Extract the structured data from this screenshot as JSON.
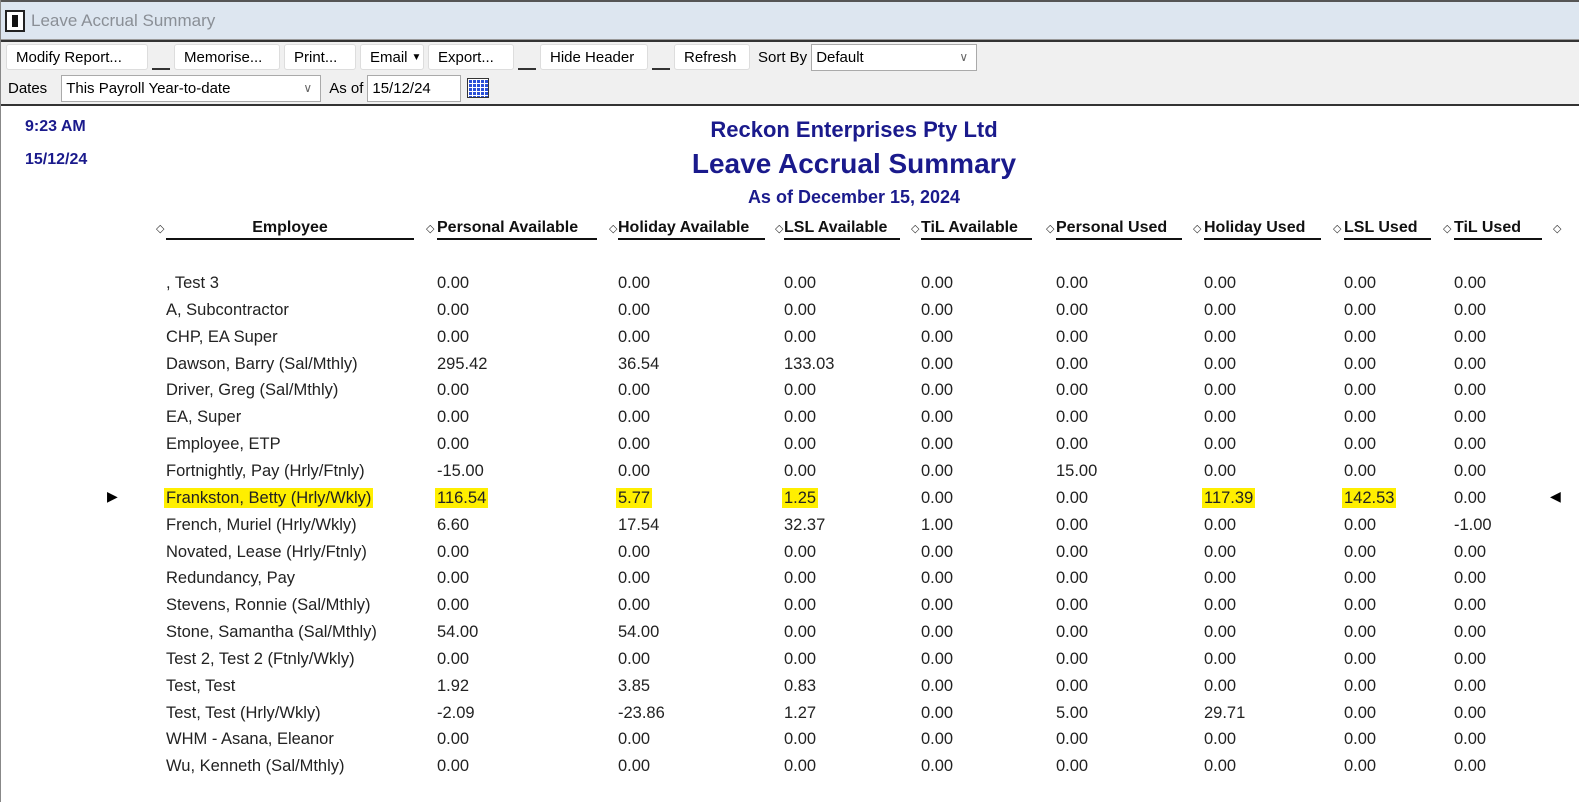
{
  "window": {
    "title": "Leave Accrual Summary"
  },
  "toolbar": {
    "modify": "Modify Report...",
    "memorise": "Memorise...",
    "print": "Print...",
    "email": "Email",
    "export": "Export...",
    "hide_header": "Hide Header",
    "refresh": "Refresh",
    "sort_by_label": "Sort By",
    "sort_by_value": "Default"
  },
  "datesbar": {
    "dates_label": "Dates",
    "dates_value": "This Payroll Year-to-date",
    "as_of_label": "As of",
    "as_of_value": "15/12/24"
  },
  "report": {
    "time": "9:23 AM",
    "date": "15/12/24",
    "company": "Reckon Enterprises Pty Ltd",
    "title": "Leave Accrual Summary",
    "subtitle": "As of December 15, 2024",
    "highlight_color": "#ffef00",
    "columns": [
      "Employee",
      "Personal Available",
      "Holiday Available",
      "LSL Available",
      "TiL Available",
      "Personal Used",
      "Holiday Used",
      "LSL Used",
      "TiL Used"
    ],
    "rows": [
      {
        "cells": [
          ", Test 3",
          "0.00",
          "0.00",
          "0.00",
          "0.00",
          "0.00",
          "0.00",
          "0.00",
          "0.00"
        ]
      },
      {
        "cells": [
          "A, Subcontractor",
          "0.00",
          "0.00",
          "0.00",
          "0.00",
          "0.00",
          "0.00",
          "0.00",
          "0.00"
        ]
      },
      {
        "cells": [
          "CHP, EA Super",
          "0.00",
          "0.00",
          "0.00",
          "0.00",
          "0.00",
          "0.00",
          "0.00",
          "0.00"
        ]
      },
      {
        "cells": [
          "Dawson, Barry (Sal/Mthly)",
          "295.42",
          "36.54",
          "133.03",
          "0.00",
          "0.00",
          "0.00",
          "0.00",
          "0.00"
        ]
      },
      {
        "cells": [
          "Driver, Greg (Sal/Mthly)",
          "0.00",
          "0.00",
          "0.00",
          "0.00",
          "0.00",
          "0.00",
          "0.00",
          "0.00"
        ]
      },
      {
        "cells": [
          "EA, Super",
          "0.00",
          "0.00",
          "0.00",
          "0.00",
          "0.00",
          "0.00",
          "0.00",
          "0.00"
        ]
      },
      {
        "cells": [
          "Employee, ETP",
          "0.00",
          "0.00",
          "0.00",
          "0.00",
          "0.00",
          "0.00",
          "0.00",
          "0.00"
        ]
      },
      {
        "cells": [
          "Fortnightly, Pay (Hrly/Ftnly)",
          "-15.00",
          "0.00",
          "0.00",
          "0.00",
          "15.00",
          "0.00",
          "0.00",
          "0.00"
        ]
      },
      {
        "cells": [
          "Frankston, Betty (Hrly/Wkly)",
          "116.54",
          "5.77",
          "1.25",
          "0.00",
          "0.00",
          "117.39",
          "142.53",
          "0.00"
        ],
        "selected": true,
        "highlighted": [
          0,
          1,
          2,
          3,
          6,
          7
        ]
      },
      {
        "cells": [
          "French, Muriel (Hrly/Wkly)",
          "6.60",
          "17.54",
          "32.37",
          "1.00",
          "0.00",
          "0.00",
          "0.00",
          "-1.00"
        ]
      },
      {
        "cells": [
          "Novated, Lease  (Hrly/Ftnly)",
          "0.00",
          "0.00",
          "0.00",
          "0.00",
          "0.00",
          "0.00",
          "0.00",
          "0.00"
        ]
      },
      {
        "cells": [
          "Redundancy, Pay",
          "0.00",
          "0.00",
          "0.00",
          "0.00",
          "0.00",
          "0.00",
          "0.00",
          "0.00"
        ]
      },
      {
        "cells": [
          "Stevens, Ronnie (Sal/Mthly)",
          "0.00",
          "0.00",
          "0.00",
          "0.00",
          "0.00",
          "0.00",
          "0.00",
          "0.00"
        ]
      },
      {
        "cells": [
          "Stone, Samantha (Sal/Mthly)",
          "54.00",
          "54.00",
          "0.00",
          "0.00",
          "0.00",
          "0.00",
          "0.00",
          "0.00"
        ]
      },
      {
        "cells": [
          "Test 2, Test 2 (Ftnly/Wkly)",
          "0.00",
          "0.00",
          "0.00",
          "0.00",
          "0.00",
          "0.00",
          "0.00",
          "0.00"
        ]
      },
      {
        "cells": [
          "Test, Test",
          "1.92",
          "3.85",
          "0.83",
          "0.00",
          "0.00",
          "0.00",
          "0.00",
          "0.00"
        ]
      },
      {
        "cells": [
          "Test, Test (Hrly/Wkly)",
          "-2.09",
          "-23.86",
          "1.27",
          "0.00",
          "5.00",
          "29.71",
          "0.00",
          "0.00"
        ]
      },
      {
        "cells": [
          "WHM - Asana, Eleanor",
          "0.00",
          "0.00",
          "0.00",
          "0.00",
          "0.00",
          "0.00",
          "0.00",
          "0.00"
        ]
      },
      {
        "cells": [
          "Wu, Kenneth (Sal/Mthly)",
          "0.00",
          "0.00",
          "0.00",
          "0.00",
          "0.00",
          "0.00",
          "0.00",
          "0.00"
        ]
      }
    ]
  }
}
